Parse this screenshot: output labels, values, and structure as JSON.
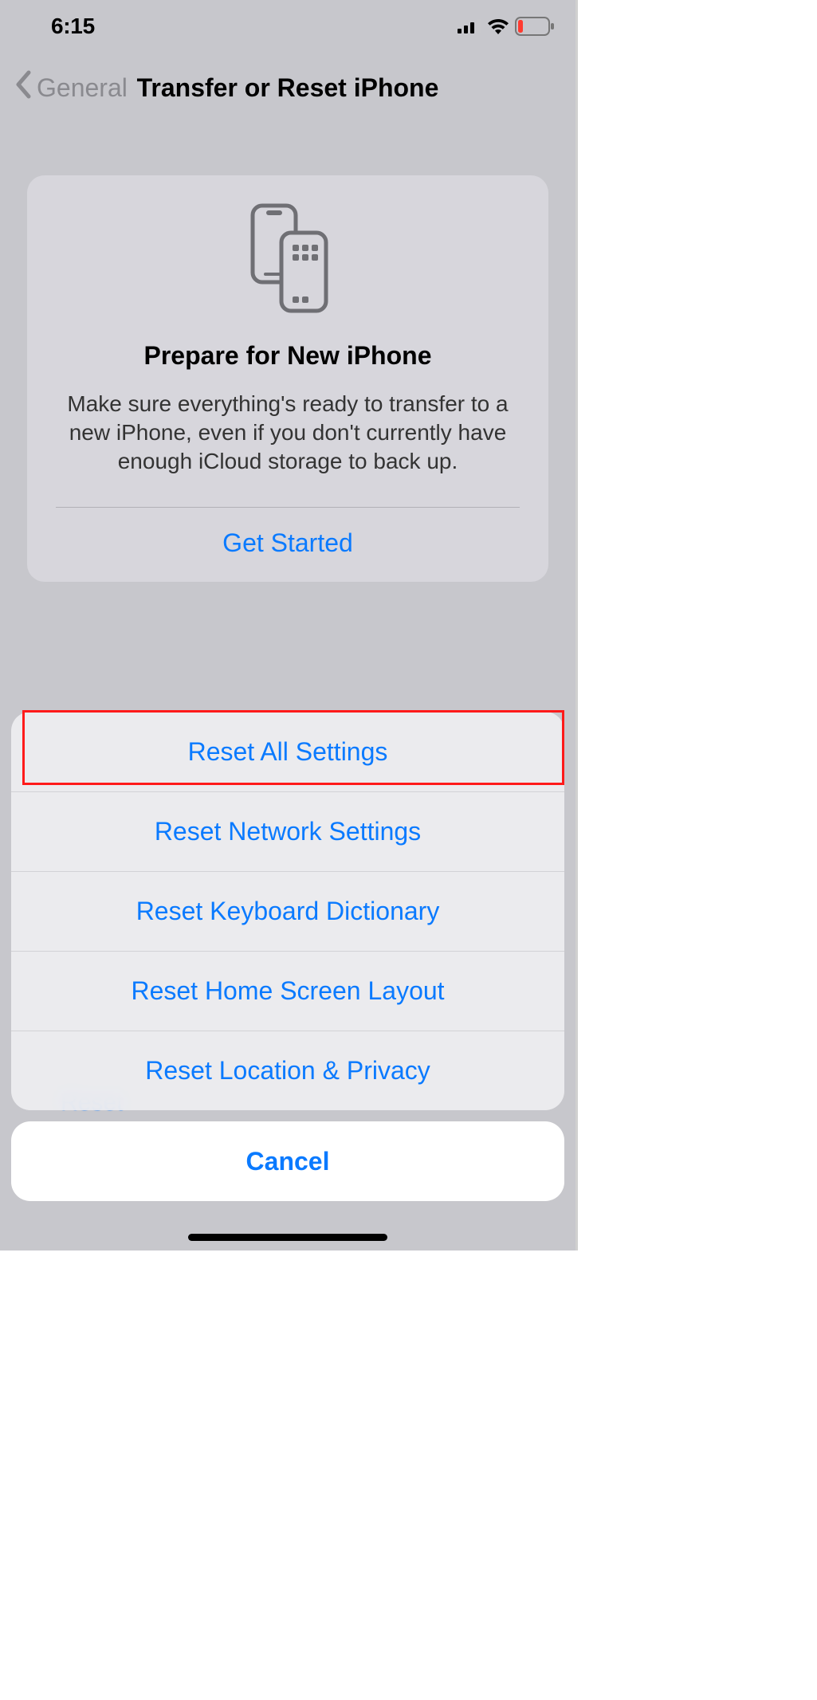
{
  "status": {
    "time": "6:15"
  },
  "nav": {
    "back_label": "General",
    "title": "Transfer or Reset iPhone"
  },
  "card": {
    "title": "Prepare for New iPhone",
    "body": "Make sure everything's ready to transfer to a new iPhone, even if you don't currently have enough iCloud storage to back up.",
    "cta": "Get Started"
  },
  "peek": {
    "text": "Reset"
  },
  "sheet": {
    "items": [
      "Reset All Settings",
      "Reset Network Settings",
      "Reset Keyboard Dictionary",
      "Reset Home Screen Layout",
      "Reset Location & Privacy"
    ],
    "cancel": "Cancel"
  }
}
